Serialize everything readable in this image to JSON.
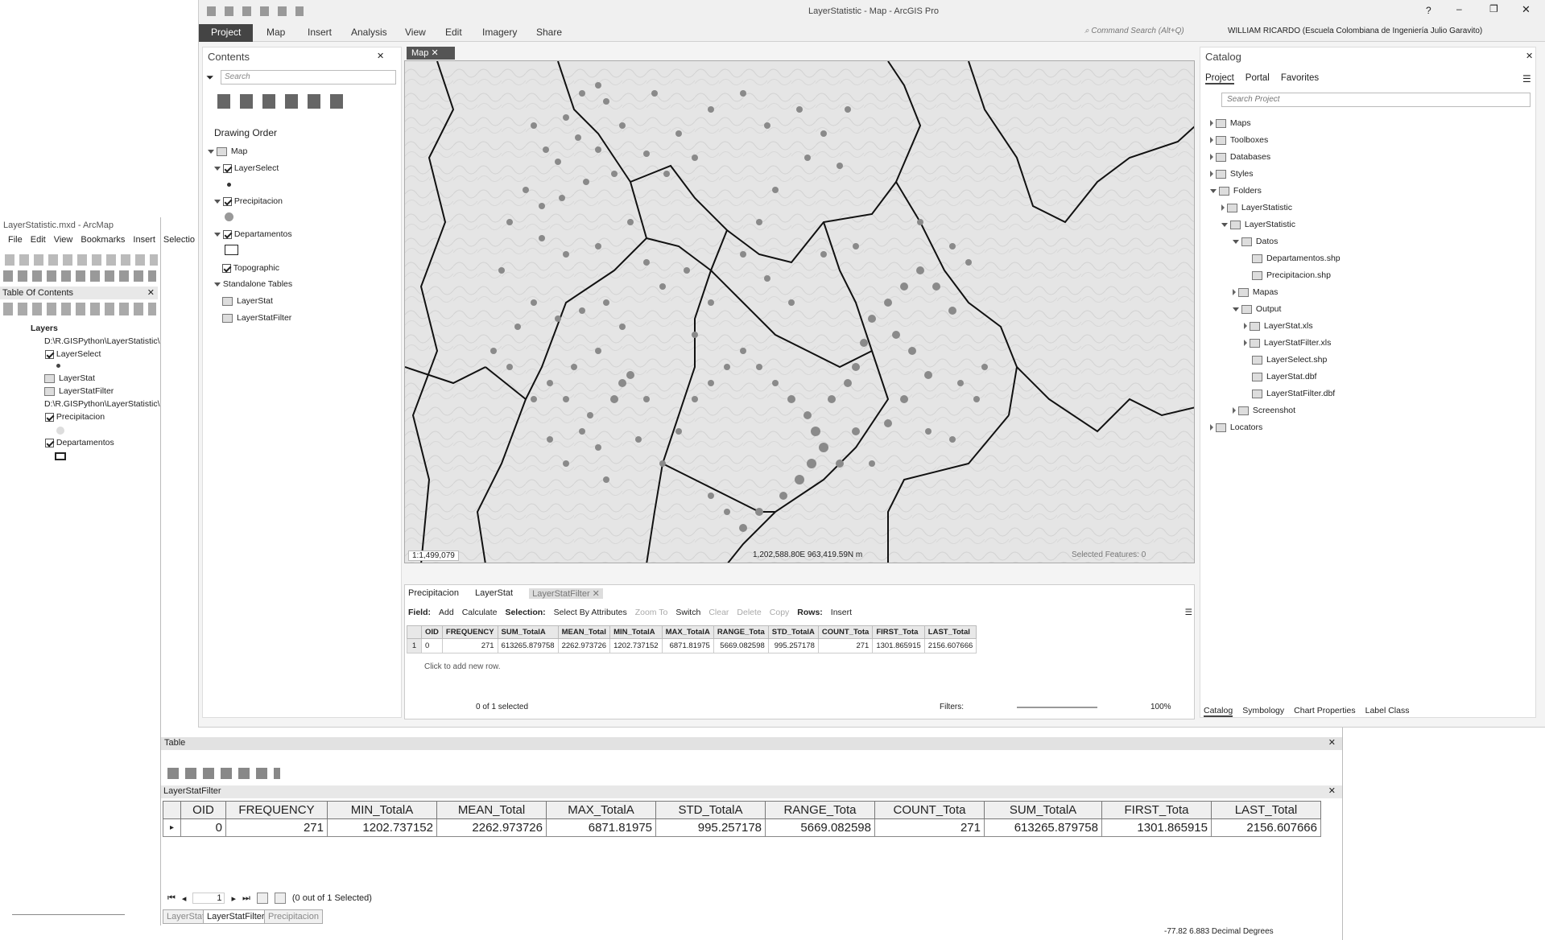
{
  "pro": {
    "title": "LayerStatistic - Map - ArcGIS Pro",
    "help": "?",
    "command_search": "Command Search (Alt+Q)",
    "user": "WILLIAM RICARDO (Escuela Colombiana de Ingeniería Julio Garavito)",
    "ribbon_tabs": [
      "Project",
      "Map",
      "Insert",
      "Analysis",
      "View",
      "Edit",
      "Imagery",
      "Share"
    ],
    "contents": {
      "title": "Contents",
      "search_placeholder": "Search",
      "drawing_order": "Drawing Order",
      "items": [
        "Map",
        "LayerSelect",
        "Precipitacion",
        "Departamentos",
        "Topographic",
        "Standalone Tables",
        "LayerStat",
        "LayerStatFilter"
      ]
    },
    "map_tab": "Map",
    "map_footer": {
      "scale": "1:1,499,079",
      "coords": "1,202,588.80E 963,419.59N m",
      "selected": "Selected Features: 0"
    },
    "table_tabs": [
      "Precipitacion",
      "LayerStat",
      "LayerStatFilter"
    ],
    "table_toolbar": {
      "field": "Field:",
      "add": "Add",
      "calculate": "Calculate",
      "selection": "Selection:",
      "select_by_attr": "Select By Attributes",
      "zoom_to": "Zoom To",
      "switch": "Switch",
      "clear": "Clear",
      "delete": "Delete",
      "copy": "Copy",
      "rows": "Rows:",
      "insert": "Insert"
    },
    "table_columns": [
      "OID",
      "FREQUENCY",
      "SUM_TotalA",
      "MEAN_Total",
      "MIN_TotalA",
      "MAX_TotalA",
      "RANGE_Tota",
      "STD_TotalA",
      "COUNT_Tota",
      "FIRST_Tota",
      "LAST_Total"
    ],
    "table_row": {
      "idx": "1",
      "values": [
        "0",
        "271",
        "613265.879758",
        "2262.973726",
        "1202.737152",
        "6871.81975",
        "5669.082598",
        "995.257178",
        "271",
        "1301.865915",
        "2156.607666"
      ]
    },
    "add_row": "Click to add new row.",
    "table_status": "0 of 1 selected",
    "filters": "Filters:",
    "zoom_pct": "100%",
    "catalog": {
      "title": "Catalog",
      "tabs": [
        "Project",
        "Portal",
        "Favorites"
      ],
      "search_placeholder": "Search Project",
      "tree": [
        "Maps",
        "Toolboxes",
        "Databases",
        "Styles",
        "Folders",
        "LayerStatistic",
        "LayerStatistic",
        "Datos",
        "Departamentos.shp",
        "Precipitacion.shp",
        "Mapas",
        "Output",
        "LayerStat.xls",
        "LayerStatFilter.xls",
        "LayerSelect.shp",
        "LayerStat.dbf",
        "LayerStatFilter.dbf",
        "Screenshot",
        "Locators"
      ]
    },
    "bottom_tabs": [
      "Catalog",
      "Symbology",
      "Chart Properties",
      "Label Class"
    ]
  },
  "arcmap": {
    "title": "LayerStatistic.mxd - ArcMap",
    "menu": [
      "File",
      "Edit",
      "View",
      "Bookmarks",
      "Insert",
      "Selectio"
    ],
    "toc_title": "Table Of Contents",
    "toc": [
      "Layers",
      "D:\\R.GISPython\\LayerStatistic\\",
      "LayerSelect",
      "LayerStat",
      "LayerStatFilter",
      "D:\\R.GISPython\\LayerStatistic\\",
      "Precipitacion",
      "Departamentos"
    ],
    "table_title": "Table",
    "table_name": "LayerStatFilter",
    "columns": [
      "OID",
      "FREQUENCY",
      "MIN_TotalA",
      "MEAN_Total",
      "MAX_TotalA",
      "STD_TotalA",
      "RANGE_Tota",
      "COUNT_Tota",
      "SUM_TotalA",
      "FIRST_Tota",
      "LAST_Total"
    ],
    "row": [
      "0",
      "271",
      "1202.737152",
      "2262.973726",
      "6871.81975",
      "995.257178",
      "5669.082598",
      "271",
      "613265.879758",
      "1301.865915",
      "2156.607666"
    ],
    "record": "1",
    "selected": "(0 out of 1 Selected)",
    "tabs": [
      "LayerStat",
      "LayerStatFilter",
      "Precipitacion"
    ],
    "status": "-77.82  6.883 Decimal Degrees"
  }
}
